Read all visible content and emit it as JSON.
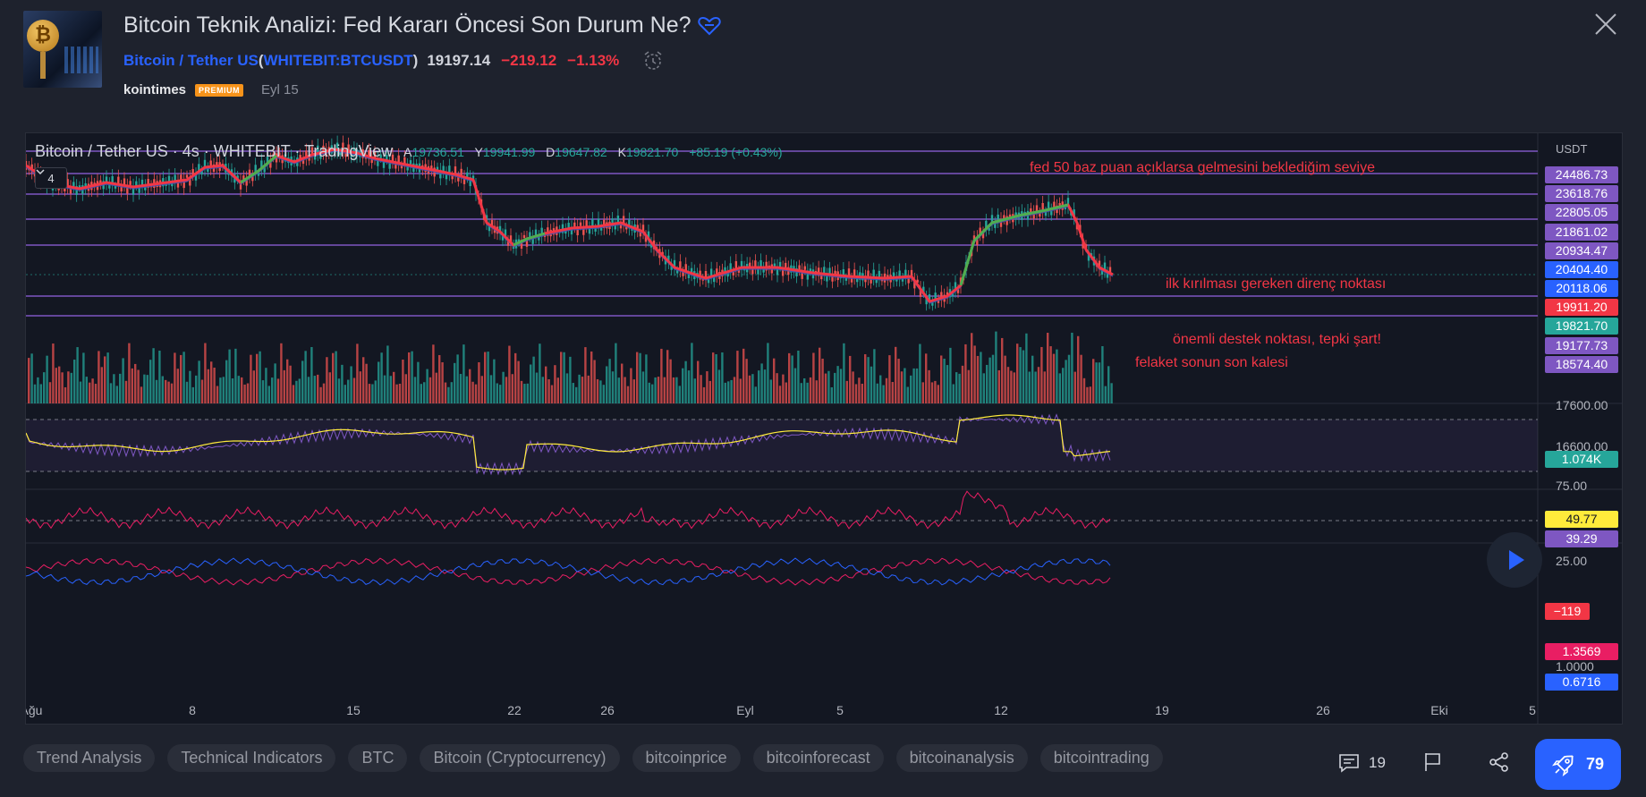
{
  "header": {
    "title": "Bitcoin Teknik Analizi: Fed Kararı Öncesi Son Durum Ne?",
    "symbol_name": "Bitcoin / Tether US",
    "symbol_open": " (",
    "symbol_code": "WHITEBIT:BTCUSDT",
    "symbol_close": ")",
    "price": "19197.14",
    "change": "−219.12",
    "change_pct": "−1.13%",
    "author": "kointimes",
    "badge": "PREMIUM",
    "date": "Eyl 15"
  },
  "chart": {
    "legend_symbol": "Bitcoin / Tether US · 4s · WHITEBIT · TradingView",
    "ohlc": [
      {
        "k": "A",
        "v": "19736.51"
      },
      {
        "k": "Y",
        "v": "19941.99"
      },
      {
        "k": "D",
        "v": "19647.82"
      },
      {
        "k": "K",
        "v": "19821.70"
      },
      {
        "k": "",
        "v": "+85.19 (+0.43%)"
      }
    ],
    "indicator_count": "4",
    "currency": "USDT",
    "price_labels": [
      {
        "text": "24486.73",
        "color": "#7e57c2"
      },
      {
        "text": "23618.76",
        "color": "#7e57c2"
      },
      {
        "text": "22805.05",
        "color": "#7e57c2"
      },
      {
        "text": "21861.02",
        "color": "#7e57c2"
      },
      {
        "text": "20934.47",
        "color": "#7e57c2"
      },
      {
        "text": "20404.40",
        "color": "#2962ff"
      },
      {
        "text": "20118.06",
        "color": "#2962ff"
      },
      {
        "text": "19911.20",
        "color": "#f23645"
      },
      {
        "text": "19821.70",
        "color": "#26a69a"
      },
      {
        "text": "19177.73",
        "color": "#7e57c2"
      },
      {
        "text": "18574.40",
        "color": "#7e57c2"
      }
    ],
    "price_scale_texts": [
      "17600.00",
      "16600.00"
    ],
    "volume_label": "1.074K",
    "rsi_scale": [
      "75.00",
      "25.00"
    ],
    "rsi_labels": [
      "49.77",
      "39.29"
    ],
    "cci_label": "−119",
    "ratio_scale": "1.0000",
    "ratio_labels": [
      "1.3569",
      "0.6716"
    ],
    "annotations": [
      "fed 50 baz puan açıklarsa gelmesini beklediğim seviye",
      "ilk kırılması gereken direnç noktası",
      "önemli destek noktası, tepki şart!",
      "felaket sonun son kalesi"
    ],
    "time_ticks": [
      "Ağu",
      "8",
      "15",
      "22",
      "26",
      "Eyl",
      "5",
      "12",
      "19",
      "26",
      "Eki",
      "5"
    ],
    "colors": {
      "up": "#26a69a",
      "down": "#ef5350",
      "level": "#7e57c2",
      "ma_up": "#4caf50",
      "ma_down": "#f23645"
    }
  },
  "tags": [
    "Trend Analysis",
    "Technical Indicators",
    "BTC",
    "Bitcoin (Cryptocurrency)",
    "bitcoinprice",
    "bitcoinforecast",
    "bitcoinanalysis",
    "bitcointrading"
  ],
  "footer": {
    "comments": "19",
    "boosts": "79"
  },
  "icons": [
    "bitcoin-avatar",
    "heart-icon",
    "close-icon",
    "alarm-clock-icon",
    "chevron-down-icon",
    "play-icon",
    "comment-icon",
    "flag-icon",
    "share-icon",
    "rocket-icon"
  ]
}
